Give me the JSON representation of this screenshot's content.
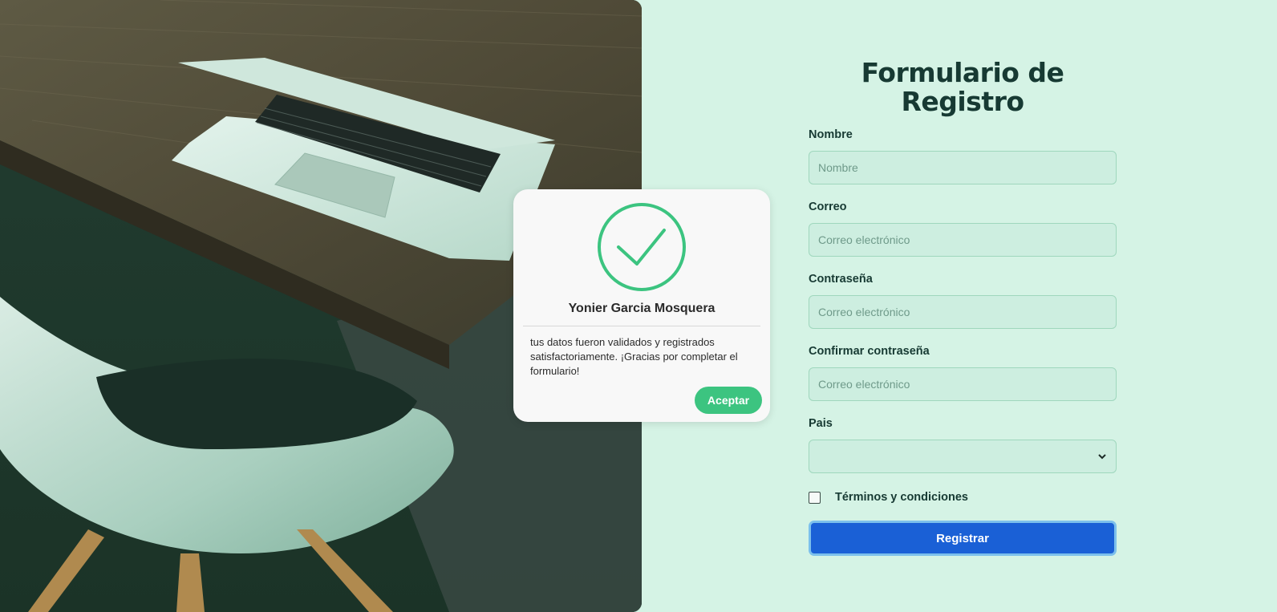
{
  "form": {
    "title_line1": "Formulario de",
    "title_line2": "Registro",
    "fields": [
      {
        "label": "Nombre",
        "placeholder": "Nombre",
        "value": ""
      },
      {
        "label": "Correo",
        "placeholder": "Correo electrónico",
        "value": ""
      },
      {
        "label": "Contraseña",
        "placeholder": "Correo electrónico",
        "value": ""
      },
      {
        "label": "Confirmar contraseña",
        "placeholder": "Correo electrónico",
        "value": ""
      }
    ],
    "country": {
      "label": "Pais",
      "selected": ""
    },
    "terms": {
      "label": "Términos y condiciones",
      "checked": false
    },
    "submit_label": "Registrar"
  },
  "modal": {
    "icon": "check-circle-icon",
    "name": "Yonier Garcia Mosquera",
    "message": "tus datos fueron validados y registrados satisfactoriamente. ¡Gracias por completar el formulario!",
    "accept_label": "Aceptar"
  },
  "hero": {
    "subject": "laptop on wooden desk with white chair"
  },
  "colors": {
    "background": "#d5f3e5",
    "input_bg": "#cdeee0",
    "title": "#173a33",
    "primary_button": "#1a60d6",
    "success": "#3cc480"
  }
}
